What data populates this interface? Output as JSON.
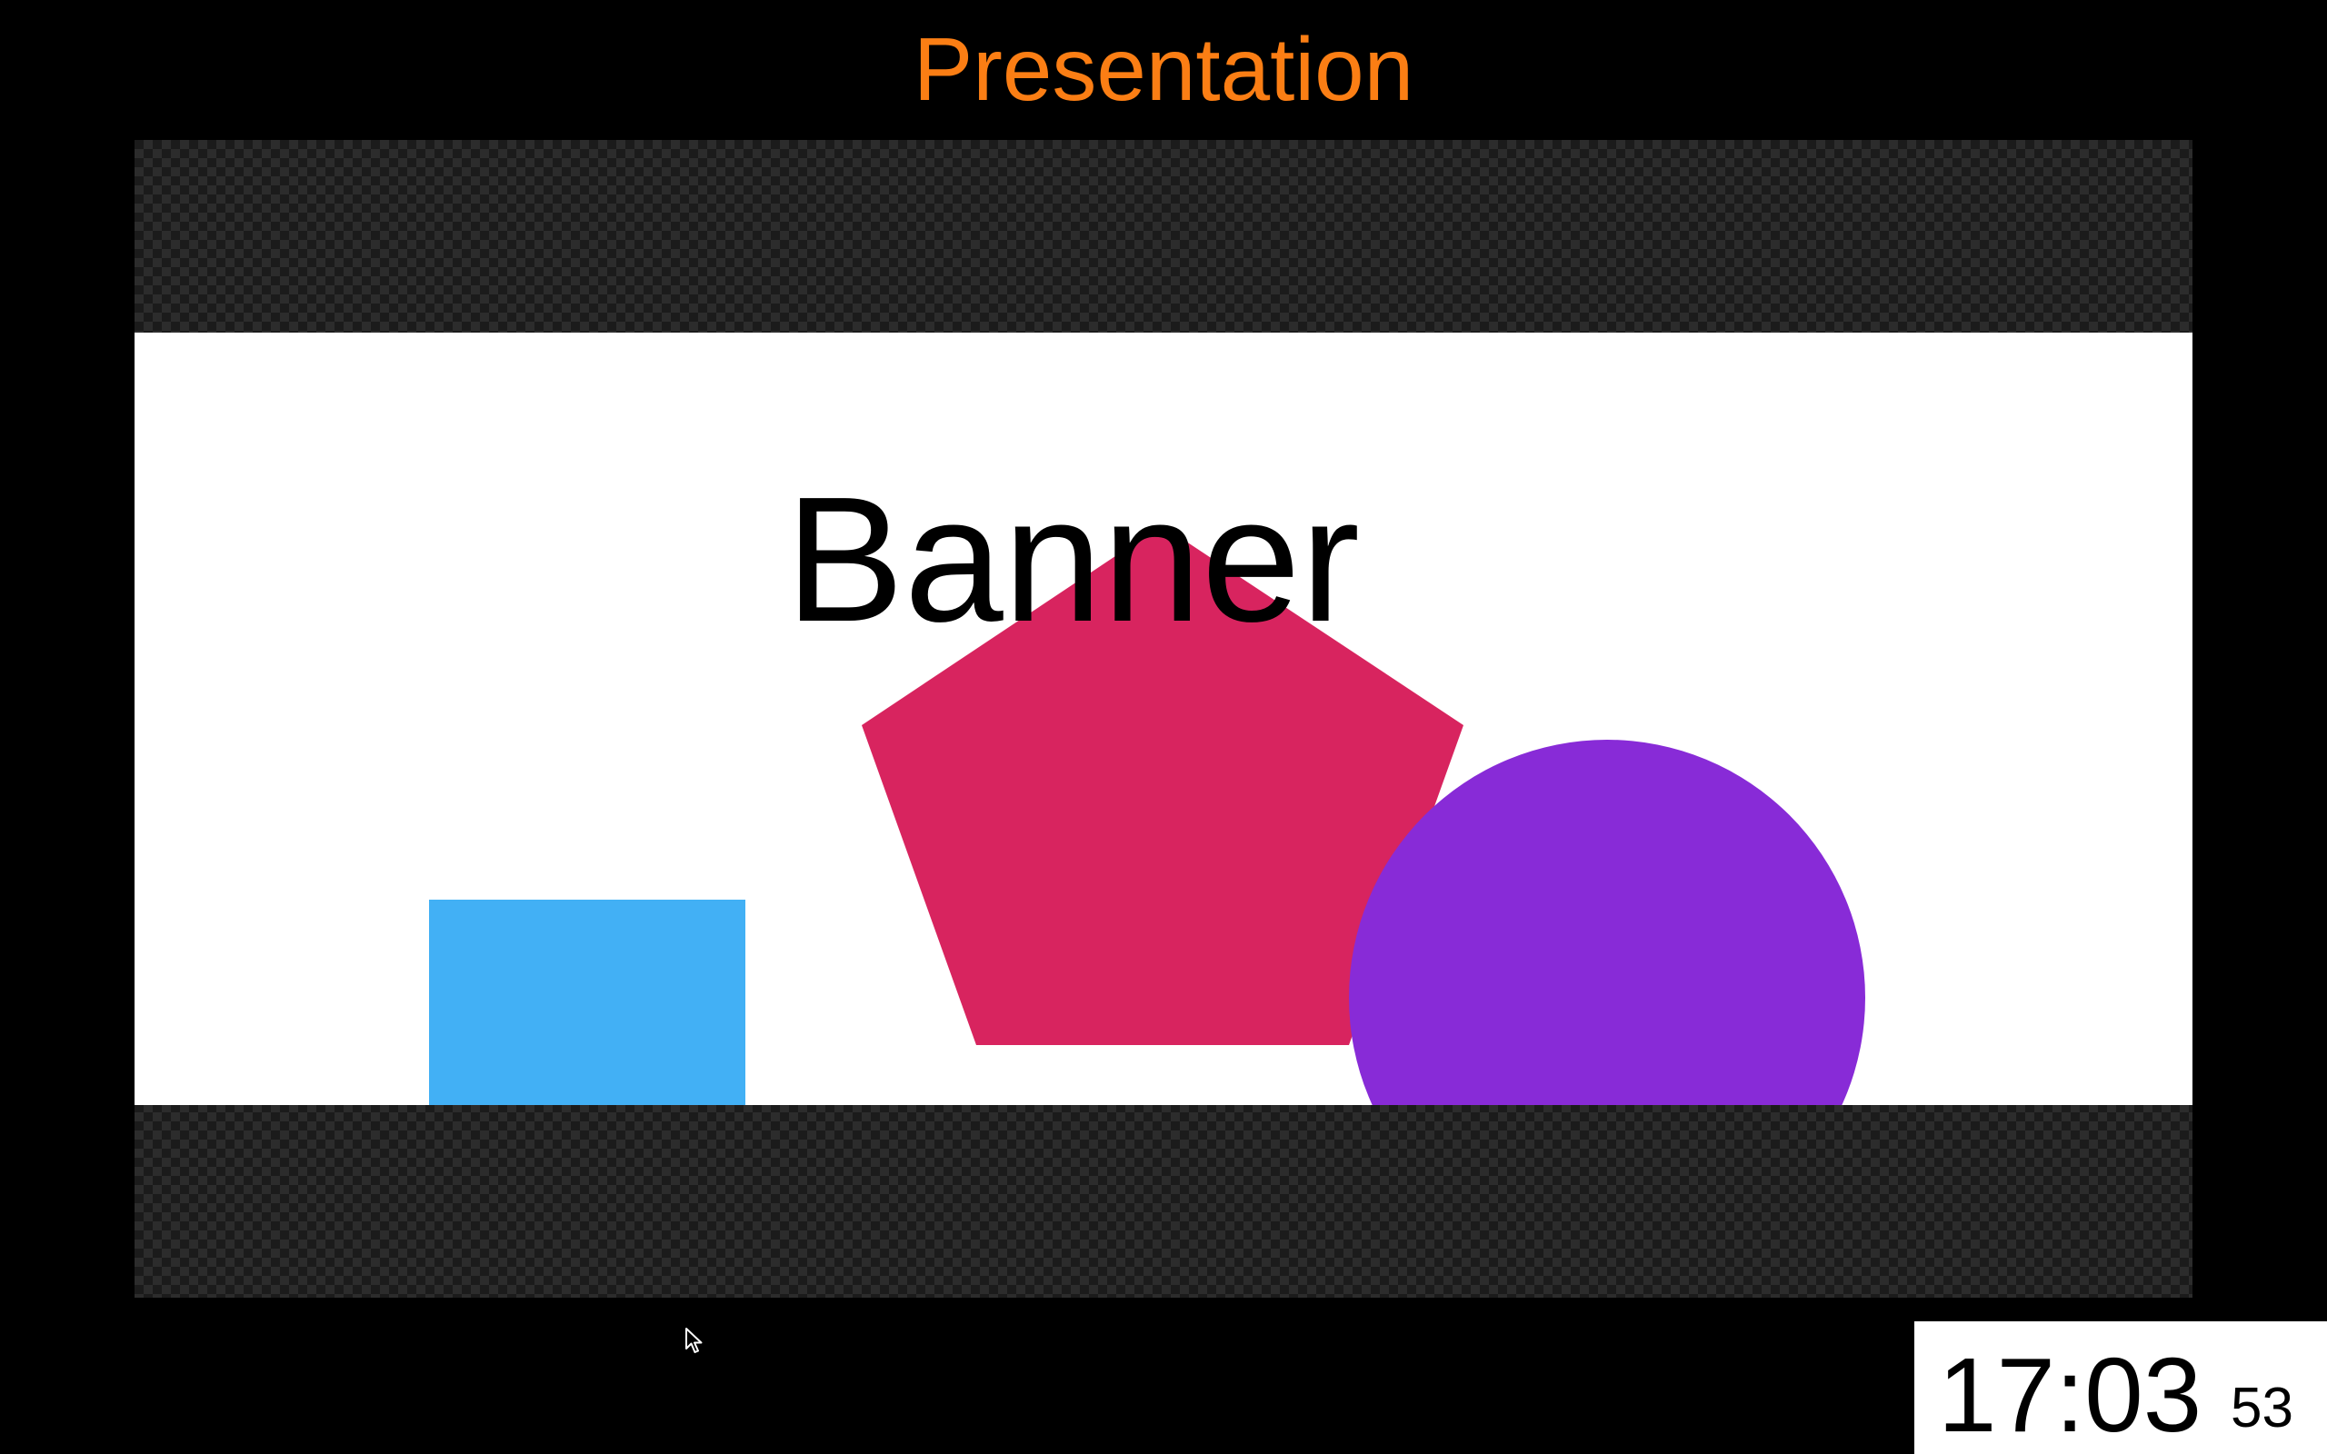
{
  "window": {
    "title": "Presentation",
    "title_color": "#fb7e14",
    "background": "#000000"
  },
  "slide": {
    "banner_text": "Banner",
    "background": "#ffffff",
    "shapes": [
      {
        "kind": "rectangle",
        "color": "#42b0f5"
      },
      {
        "kind": "pentagon",
        "color": "#d8245f"
      },
      {
        "kind": "circle",
        "color": "#882bd7"
      }
    ]
  },
  "clock": {
    "time": "17:03",
    "seconds": "53"
  },
  "cursor": {
    "icon": "arrow-pointer-icon"
  }
}
